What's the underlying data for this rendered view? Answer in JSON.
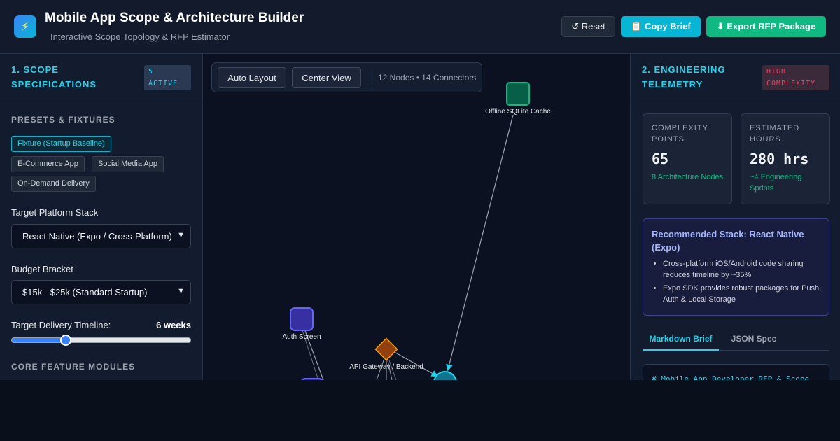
{
  "header": {
    "title": "Mobile App Scope & Architecture Builder",
    "subtitle": "Interactive Scope Topology & RFP Estimator",
    "reset_label": "↺ Reset",
    "copy_label": "📋 Copy Brief",
    "export_label": "⬇ Export RFP Package",
    "logo_icon": "lightning-icon"
  },
  "left": {
    "title": "1. Scope Specifications",
    "badge": "5 Active",
    "presets_label": "Presets & Fixtures",
    "presets": [
      "Fixture (Startup Baseline)",
      "E-Commerce App",
      "Social Media App",
      "On-Demand Delivery"
    ],
    "platform_label": "Target Platform Stack",
    "platform_value": "React Native (Expo / Cross-Platform)",
    "budget_label": "Budget Bracket",
    "budget_value": "$15k - $25k (Standard Startup)",
    "timeline_label": "Target Delivery Timeline:",
    "timeline_value": "6 weeks",
    "timeline_fraction": 0.3,
    "features_label": "Core Feature Modules"
  },
  "canvas": {
    "auto_layout_label": "Auto Layout",
    "center_view_label": "Center View",
    "stats": "12 Nodes • 14 Connectors",
    "nodes": {
      "sqlite": "Offline SQLite Cache",
      "auth": "Auth Screen",
      "gateway": "API Gateway / Backend"
    }
  },
  "right": {
    "title": "2. Engineering Telemetry",
    "badge": "High Complexity",
    "complexity_label": "Complexity Points",
    "complexity_value": "65",
    "complexity_sub": "8 Architecture Nodes",
    "hours_label": "Estimated Hours",
    "hours_value": "280 hrs",
    "hours_sub": "~4 Engineering Sprints",
    "reco_title": "Recommended Stack: React Native (Expo)",
    "reco_items": [
      "Cross-platform iOS/Android code sharing reduces timeline by ~35%",
      "Expo SDK provides robust packages for Push, Auth & Local Storage"
    ],
    "tab_markdown": "Markdown Brief",
    "tab_json": "JSON Spec",
    "code_first_line": "# Mobile App Developer RFP & Scope"
  },
  "colors": {
    "accent": "#22d3ee",
    "success": "#10b981",
    "danger": "#f43f5e",
    "indigo": "#a5b4fc"
  }
}
